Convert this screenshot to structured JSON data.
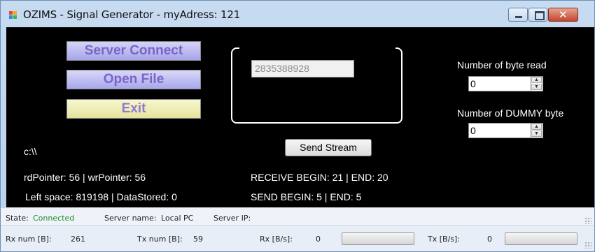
{
  "window": {
    "title": "OZIMS - Signal Generator - myAdress: 121"
  },
  "buttons": {
    "server_connect": "Server Connect",
    "open_file": "Open File",
    "exit": "Exit",
    "send_stream": "Send Stream"
  },
  "stream_field": {
    "value": "2835388928"
  },
  "settings": {
    "bytes_read_label": "Number of byte read",
    "bytes_read_value": "0",
    "dummy_label": "Number of DUMMY byte",
    "dummy_value": "0"
  },
  "info": {
    "path": "c:\\\\",
    "pointers": "rdPointer: 56 | wrPointer: 56",
    "space": "Left space: 819198 | DataStored: 0",
    "receive": "RECEIVE BEGIN: 21  |  END: 20",
    "send": "SEND BEGIN: 5  |  END: 5"
  },
  "status1": {
    "state_label": "State:",
    "state_value": "Connected",
    "server_name_label": "Server name:",
    "server_name_value": "Local PC",
    "server_ip_label": "Server IP:",
    "server_ip_value": ""
  },
  "status2": {
    "rx_num_label": "Rx num [B]:",
    "rx_num_value": "261",
    "tx_num_label": "Tx num [B]:",
    "tx_num_value": "59",
    "rx_rate_label": "Rx [B/s]:",
    "rx_rate_value": "0",
    "rx_progress": 0,
    "tx_rate_label": "Tx [B/s]:",
    "tx_rate_value": "0",
    "tx_progress": 0
  },
  "colors": {
    "background": "#000000",
    "connected": "#1a8d2a",
    "button_text": "#7a64c8"
  }
}
